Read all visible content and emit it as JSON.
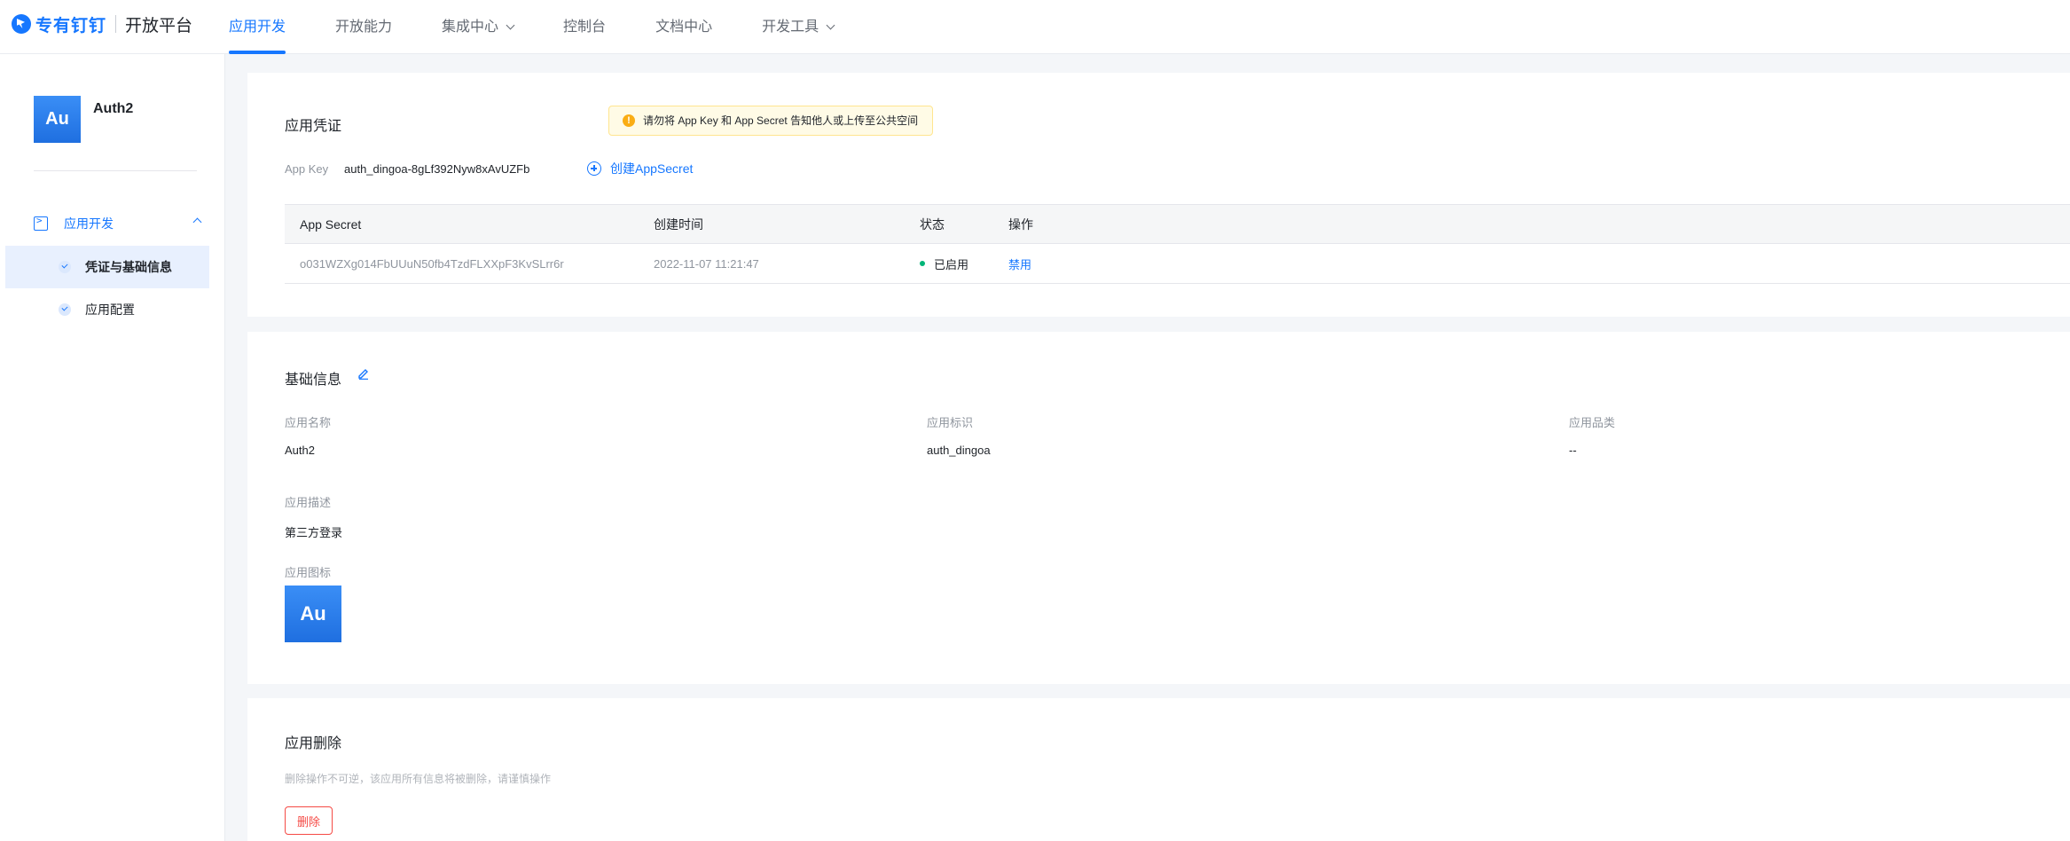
{
  "header": {
    "brand": "专有钉钉",
    "platform": "开放平台",
    "nav": [
      {
        "label": "应用开发",
        "active": true,
        "has_dropdown": false
      },
      {
        "label": "开放能力",
        "active": false,
        "has_dropdown": false
      },
      {
        "label": "集成中心",
        "active": false,
        "has_dropdown": true
      },
      {
        "label": "控制台",
        "active": false,
        "has_dropdown": false
      },
      {
        "label": "文档中心",
        "active": false,
        "has_dropdown": false
      },
      {
        "label": "开发工具",
        "active": false,
        "has_dropdown": true
      }
    ]
  },
  "sidebar": {
    "app_avatar_text": "Au",
    "app_name": "Auth2",
    "group_label": "应用开发",
    "items": [
      {
        "label": "凭证与基础信息",
        "active": true
      },
      {
        "label": "应用配置",
        "active": false
      }
    ]
  },
  "credentials": {
    "title": "应用凭证",
    "warning": "请勿将 App Key 和 App Secret 告知他人或上传至公共空间",
    "app_key_label": "App Key",
    "app_key_value": "auth_dingoa-8gLf392Nyw8xAvUZFb",
    "create_secret_label": "创建AppSecret",
    "table": {
      "columns": [
        "App Secret",
        "创建时间",
        "状态",
        "操作"
      ],
      "rows": [
        {
          "secret": "o031WZXg014FbUUuN50fb4TzdFLXXpF3KvSLrr6r",
          "created": "2022-11-07 11:21:47",
          "status": "已启用",
          "action": "禁用"
        }
      ]
    }
  },
  "basic_info": {
    "title": "基础信息",
    "fields": [
      {
        "label": "应用名称",
        "value": "Auth2"
      },
      {
        "label": "应用标识",
        "value": "auth_dingoa"
      },
      {
        "label": "应用品类",
        "value": "--"
      }
    ],
    "desc_label": "应用描述",
    "desc_value": "第三方登录",
    "icon_label": "应用图标",
    "icon_text": "Au"
  },
  "delete_section": {
    "title": "应用删除",
    "hint": "删除操作不可逆，该应用所有信息将被删除，请谨慎操作",
    "button": "删除"
  },
  "colors": {
    "primary": "#1677ff",
    "danger": "#f54a45",
    "success": "#00b578",
    "warning_bg": "#fffbe6"
  }
}
